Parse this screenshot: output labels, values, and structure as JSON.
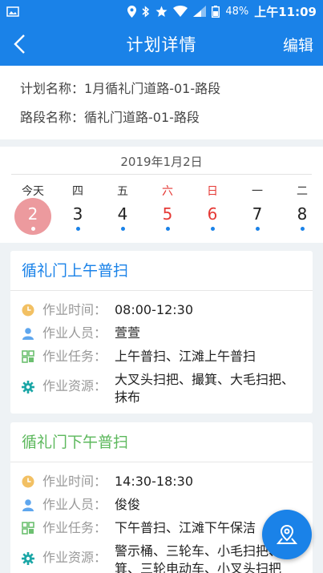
{
  "status": {
    "battery": "48%",
    "time": "上午11:09"
  },
  "appbar": {
    "title": "计划详情",
    "edit_label": "编辑"
  },
  "plan": {
    "name_label": "计划名称：",
    "name_value": "1月循礼门道路-01-路段",
    "road_label": "路段名称：",
    "road_value": "循礼门道路-01-路段"
  },
  "calendar": {
    "date": "2019年1月2日",
    "days": [
      {
        "weekday": "今天",
        "num": "2",
        "selected": true
      },
      {
        "weekday": "四",
        "num": "3"
      },
      {
        "weekday": "五",
        "num": "4"
      },
      {
        "weekday": "六",
        "num": "5",
        "weekend": true
      },
      {
        "weekday": "日",
        "num": "6",
        "weekend": true
      },
      {
        "weekday": "一",
        "num": "7"
      },
      {
        "weekday": "二",
        "num": "8"
      }
    ]
  },
  "cards": [
    {
      "title": "循礼门上午普扫",
      "time_label": "作业时间：",
      "time_value": "08:00-12:30",
      "staff_label": "作业人员：",
      "staff_value": "萱萱",
      "task_label": "作业任务：",
      "task_value": "上午普扫、江滩上午普扫",
      "resource_label": "作业资源：",
      "resource_value": "大叉头扫把、撮箕、大毛扫把、抹布"
    },
    {
      "title": "循礼门下午普扫",
      "time_label": "作业时间：",
      "time_value": "14:30-18:30",
      "staff_label": "作业人员：",
      "staff_value": "俊俊",
      "task_label": "作业任务：",
      "task_value": "下午普扫、江滩下午保洁",
      "resource_label": "作业资源：",
      "resource_value": "警示桶、三轮车、小毛扫把、撮箕、三轮电动车、小叉头扫把"
    }
  ],
  "icons": {
    "back": "chevron-left-icon",
    "clock": "clock-icon",
    "person": "person-icon",
    "task": "grid-icon",
    "resource": "gear-icon",
    "fab": "map-pin-icon"
  },
  "colors": {
    "primary": "#1a82e8",
    "weekend": "#e53935",
    "selected": "#ec9a9e",
    "card2_title": "#5cb85c"
  }
}
